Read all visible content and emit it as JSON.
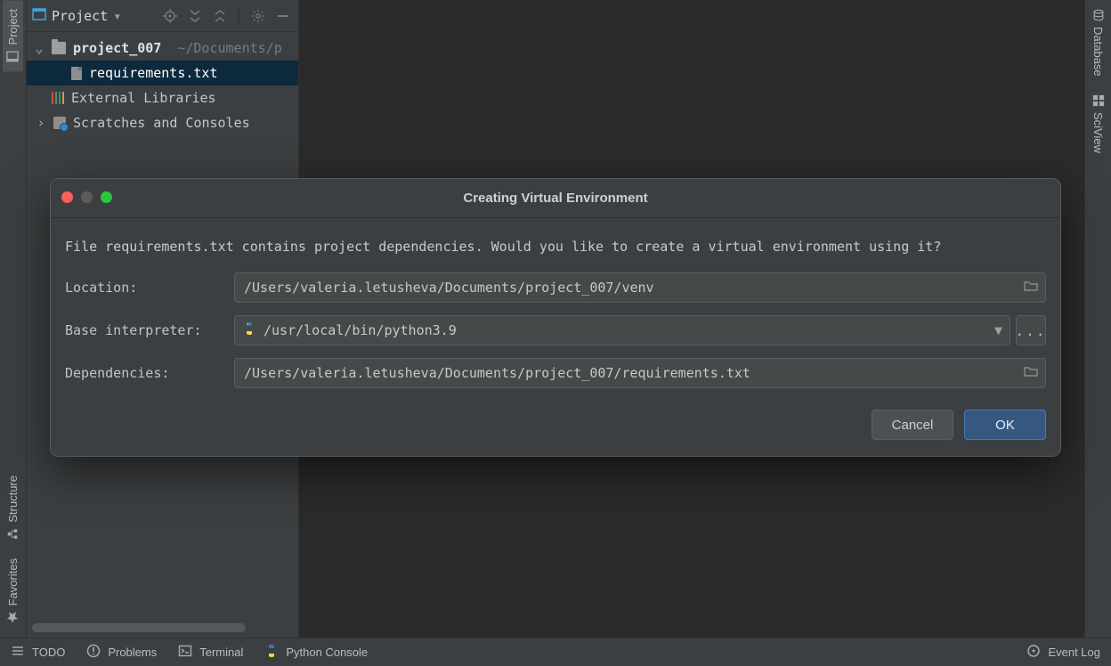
{
  "left_edge": {
    "project_label": "Project",
    "structure_label": "Structure",
    "favorites_label": "Favorites"
  },
  "right_edge": {
    "database_label": "Database",
    "sciview_label": "SciView"
  },
  "project_panel": {
    "title": "Project",
    "root": {
      "name": "project_007",
      "path_hint": "~/Documents/p"
    },
    "file_selected": "requirements.txt",
    "external_libs": "External Libraries",
    "scratches": "Scratches and Consoles"
  },
  "bottom_bar": {
    "todo": "TODO",
    "problems": "Problems",
    "terminal": "Terminal",
    "python_console": "Python Console",
    "event_log": "Event Log"
  },
  "dialog": {
    "title": "Creating Virtual Environment",
    "message": "File requirements.txt contains project dependencies. Would you like to create a virtual environment using it?",
    "location_label": "Location:",
    "location_value": "/Users/valeria.letusheva/Documents/project_007/venv",
    "interpreter_label": "Base interpreter:",
    "interpreter_value": "/usr/local/bin/python3.9",
    "dependencies_label": "Dependencies:",
    "dependencies_value": "/Users/valeria.letusheva/Documents/project_007/requirements.txt",
    "more_button": "...",
    "cancel": "Cancel",
    "ok": "OK"
  },
  "icons": {
    "project_window": "project-window-icon",
    "folder": "folder-icon",
    "file": "file-icon",
    "libraries": "libraries-icon",
    "scratches": "scratches-icon",
    "python": "python-icon"
  }
}
